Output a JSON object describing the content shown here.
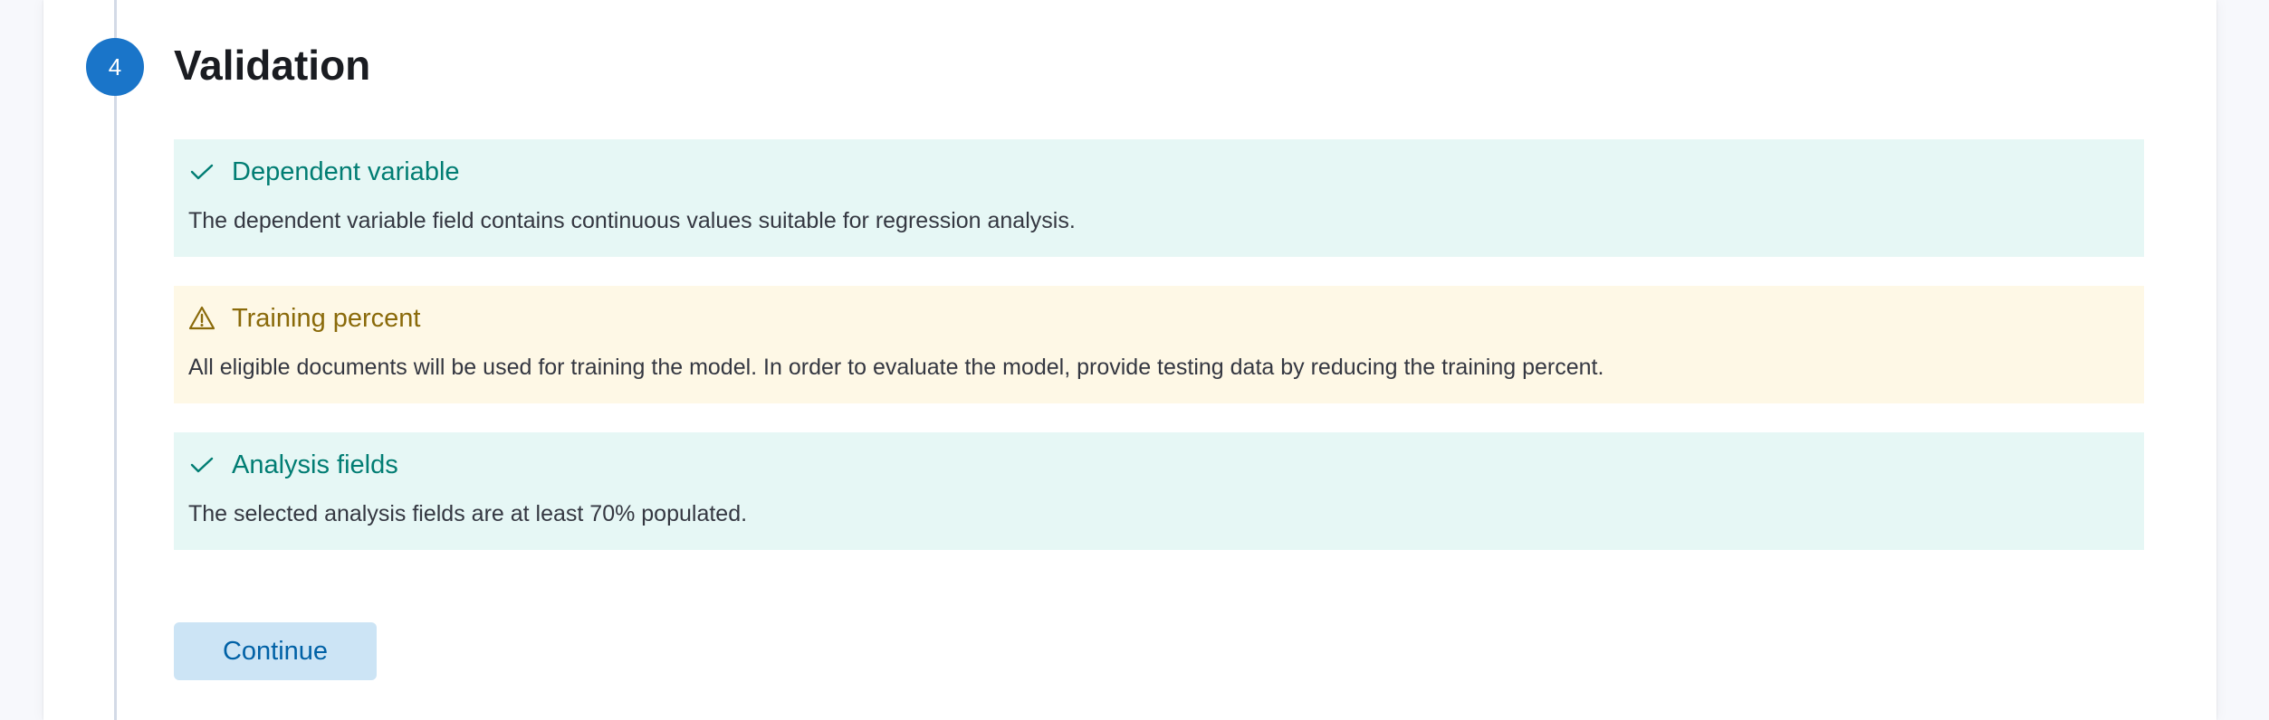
{
  "step": {
    "number": "4",
    "title": "Validation"
  },
  "callouts": [
    {
      "type": "success",
      "icon": "check-icon",
      "title": "Dependent variable",
      "body": "The dependent variable field contains continuous values suitable for regression analysis."
    },
    {
      "type": "warning",
      "icon": "warning-icon",
      "title": "Training percent",
      "body": "All eligible documents will be used for training the model. In order to evaluate the model, provide testing data by reducing the training percent."
    },
    {
      "type": "success",
      "icon": "check-icon",
      "title": "Analysis fields",
      "body": "The selected analysis fields are at least 70% populated."
    }
  ],
  "actions": {
    "continue_label": "Continue"
  },
  "colors": {
    "step_badge": "#1a75c9",
    "success_bg": "#e6f7f5",
    "success_text": "#017d73",
    "warning_bg": "#fef8e6",
    "warning_text": "#8a6a0a",
    "button_bg": "#cce4f5",
    "button_text": "#0061a6"
  }
}
